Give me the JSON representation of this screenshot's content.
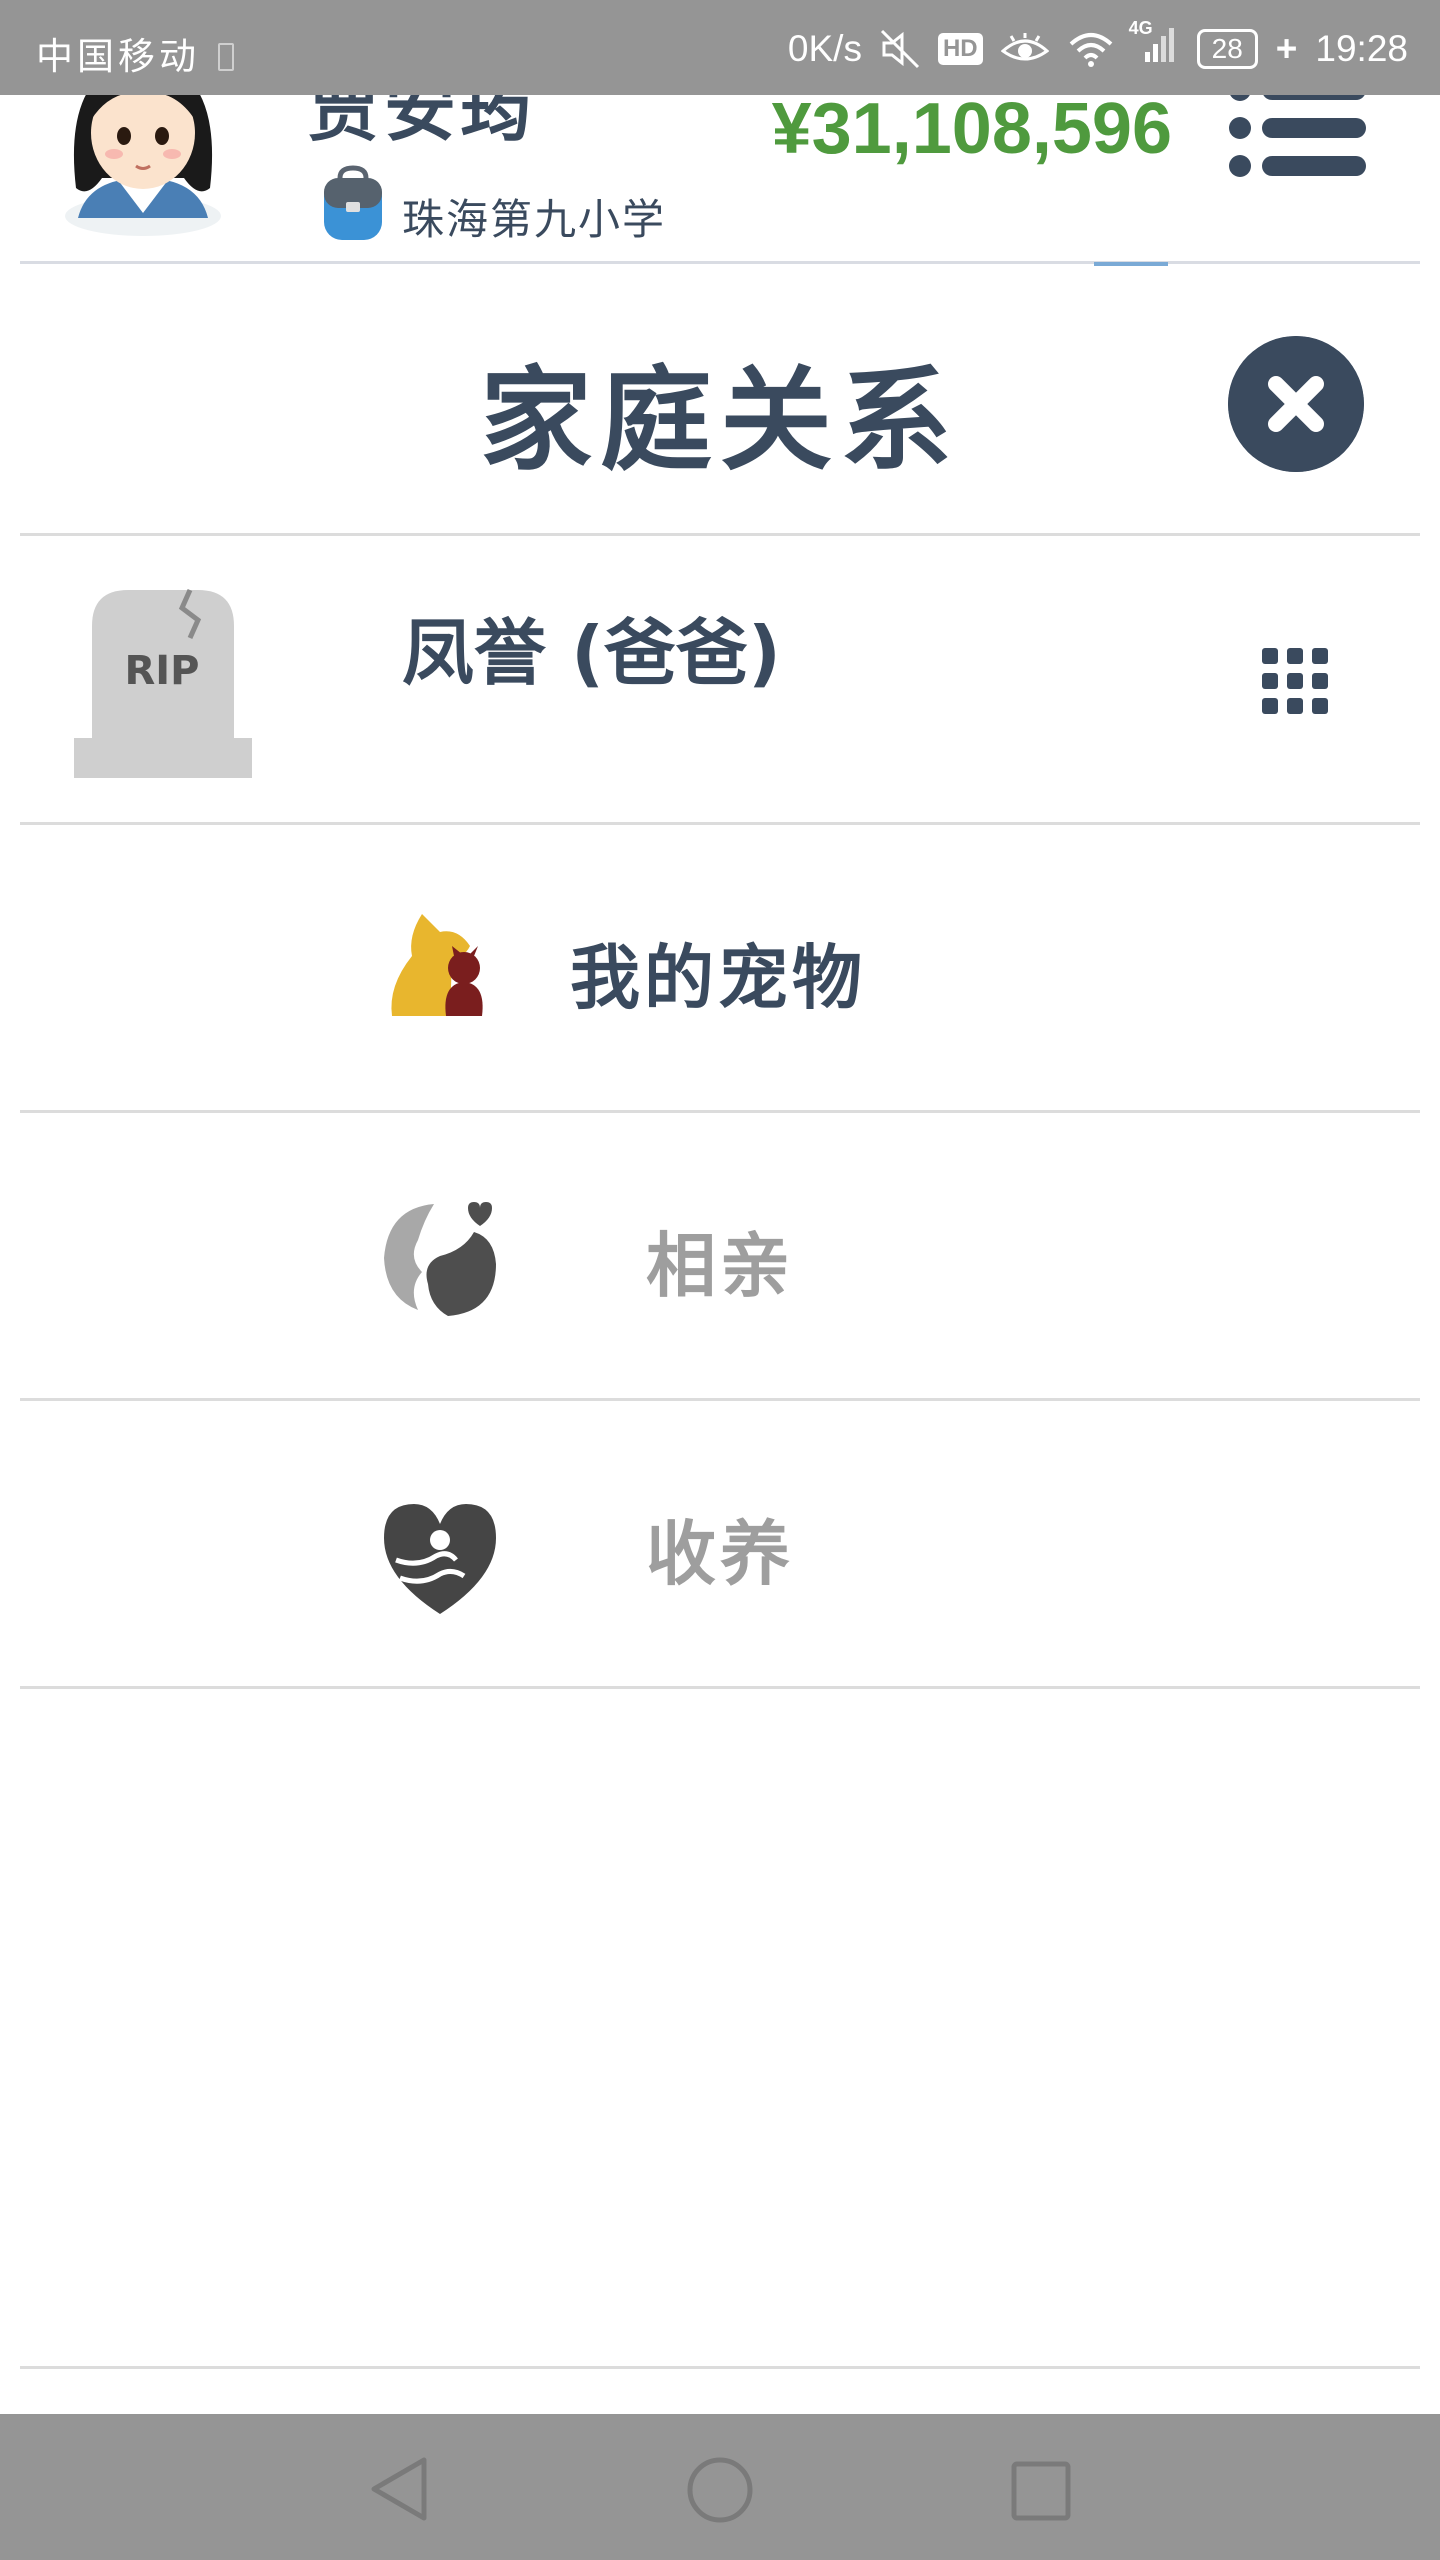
{
  "status_bar": {
    "carrier": "中国移动",
    "net_speed": "0K/s",
    "hd_badge": "HD",
    "network_type": "4G",
    "battery": "28",
    "time": "19:28"
  },
  "header": {
    "user_name": "贾安筠",
    "school": "珠海第九小学",
    "money": "¥31,108,596"
  },
  "dialog": {
    "title": "家庭关系"
  },
  "family": {
    "father_label": "凤誉 (爸爸)",
    "rip_text": "RIP"
  },
  "menu": {
    "pets_label": "我的宠物",
    "dating_label": "相亲",
    "adoption_label": "收养"
  },
  "colors": {
    "primary_text": "#3a4a5e",
    "money_green": "#4f9a3e",
    "dim_text": "#9e9e9e",
    "system_bar": "#959595"
  }
}
